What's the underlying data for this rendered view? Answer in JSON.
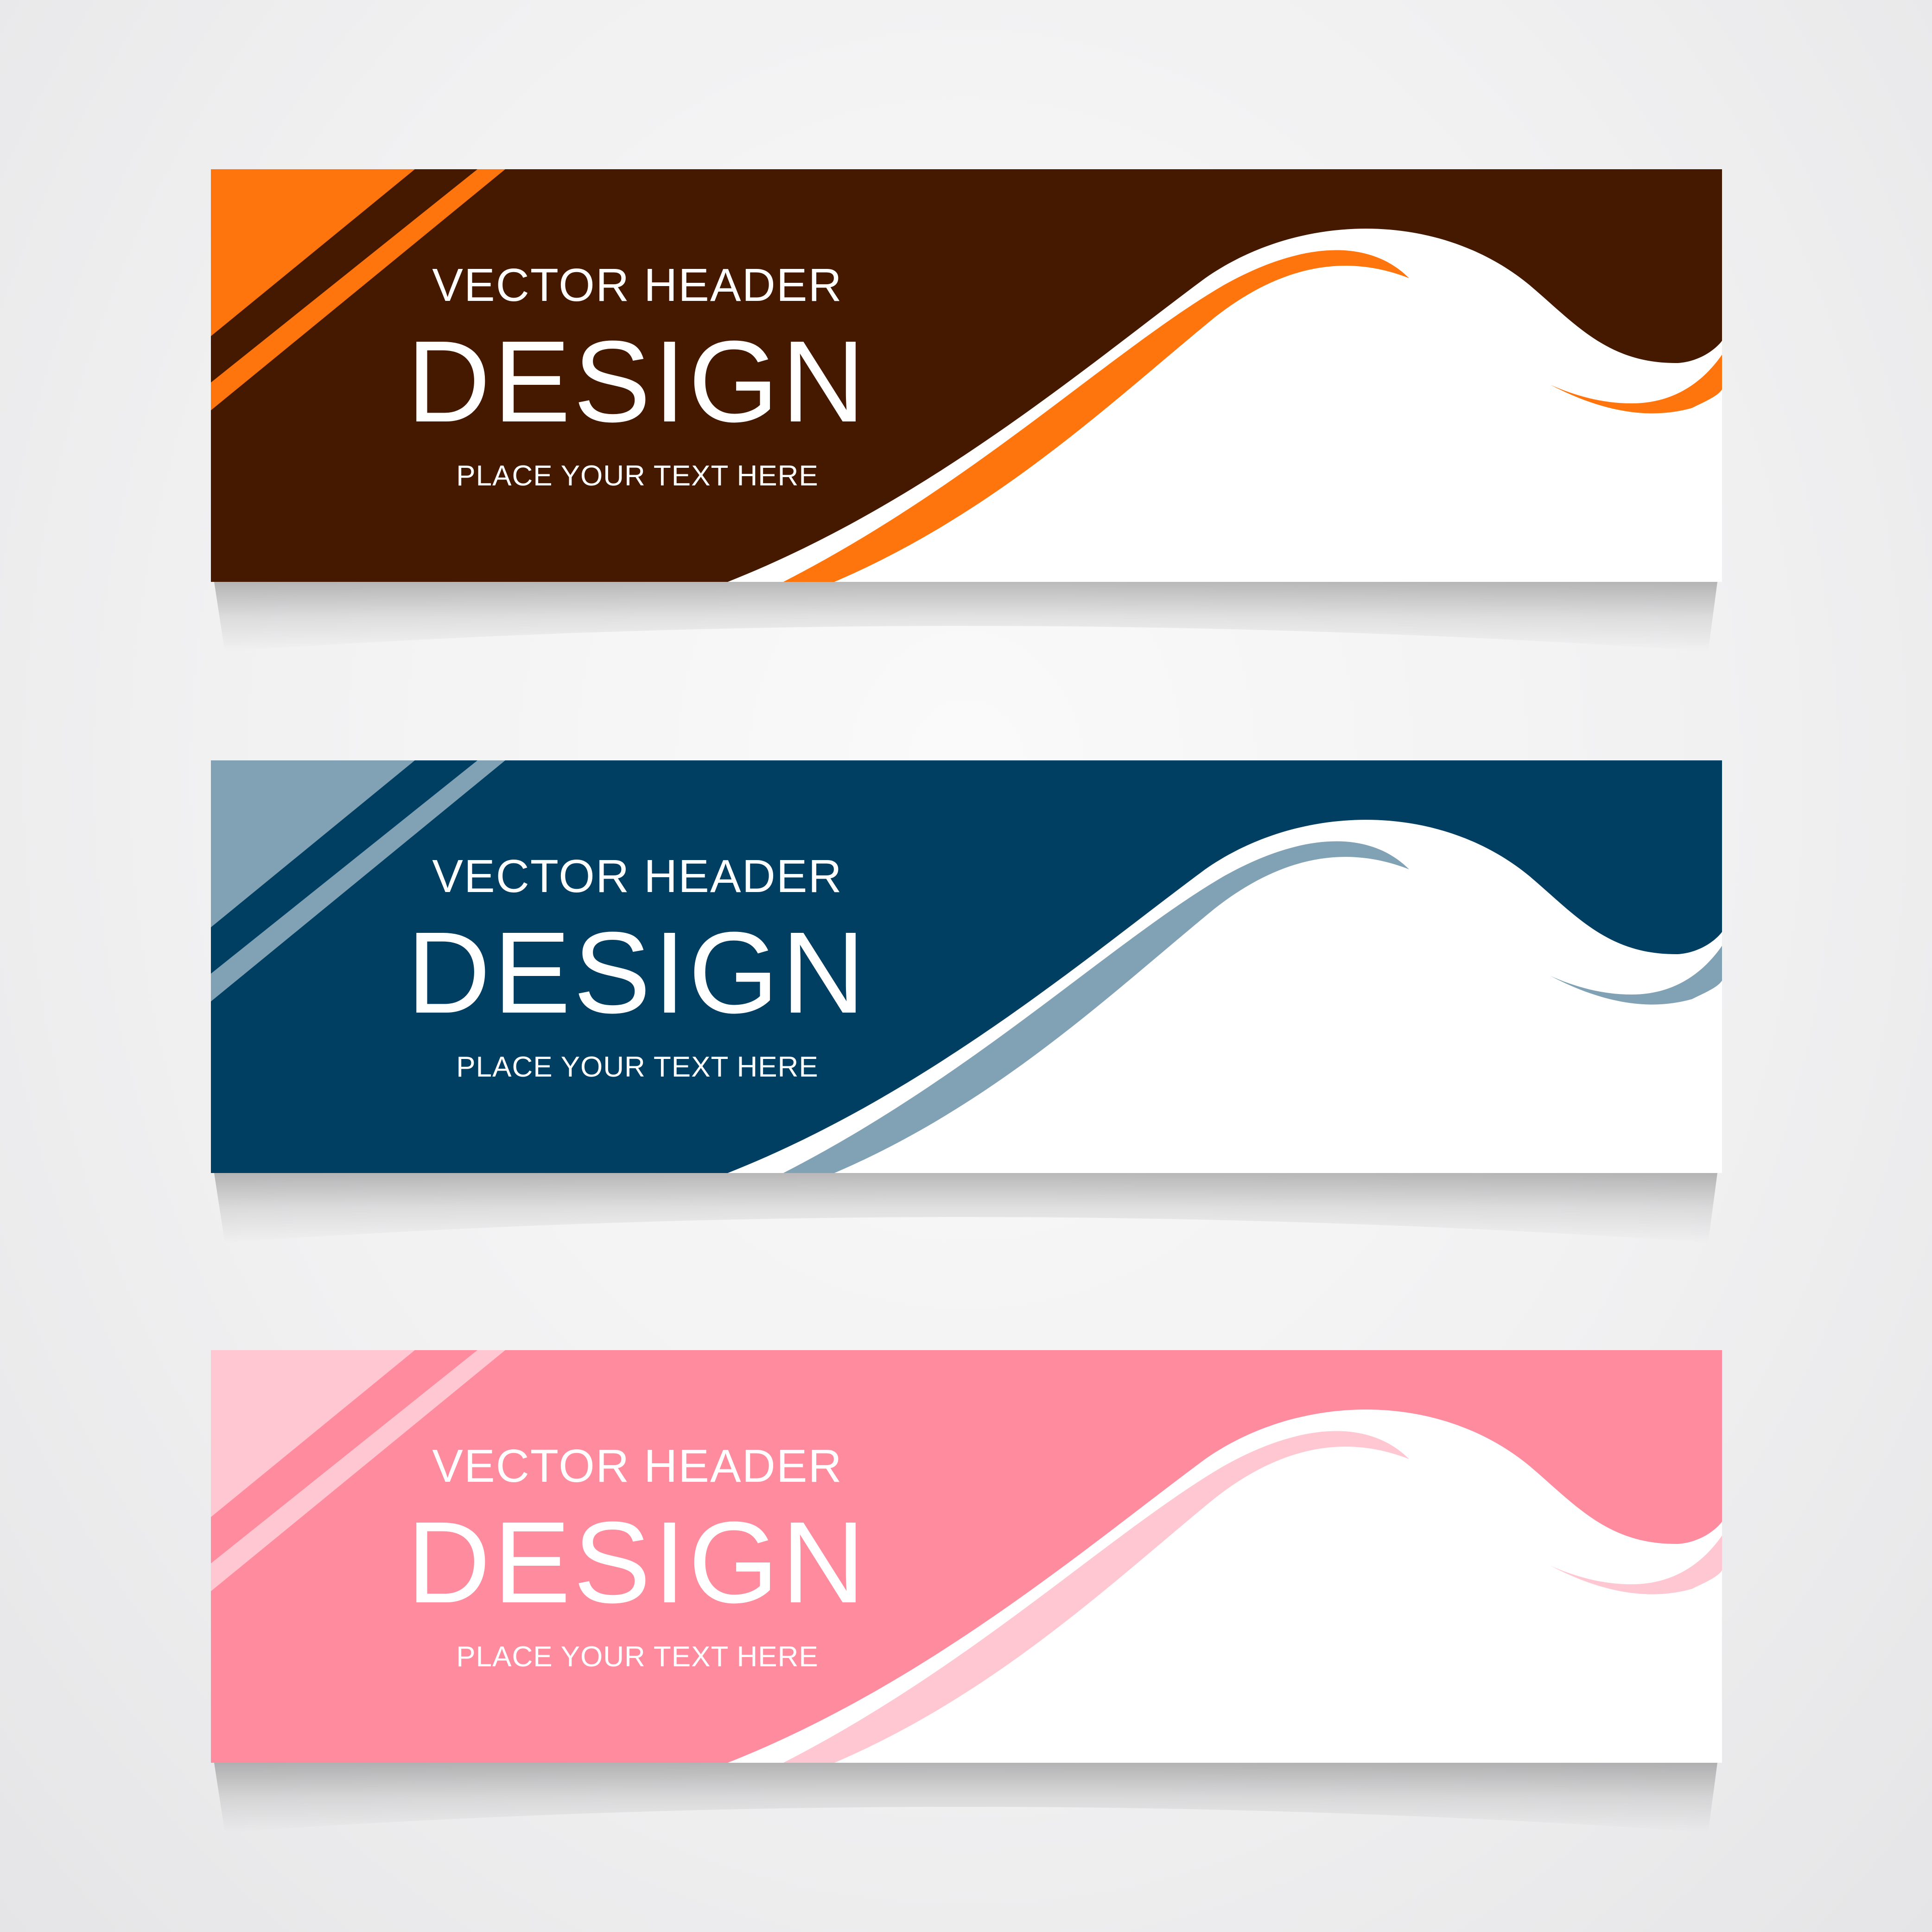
{
  "banners": [
    {
      "eyebrow": "VECTOR HEADER",
      "headline": "DESIGN",
      "tagline": "PLACE YOUR TEXT HERE",
      "colors": {
        "base": "#441900",
        "accent": "#ff750d",
        "fill": "#ffffff"
      }
    },
    {
      "eyebrow": "VECTOR HEADER",
      "headline": "DESIGN",
      "tagline": "PLACE YOUR TEXT HERE",
      "colors": {
        "base": "#003f62",
        "accent": "#81a1b5",
        "fill": "#ffffff"
      }
    },
    {
      "eyebrow": "VECTOR HEADER",
      "headline": "DESIGN",
      "tagline": "PLACE YOUR TEXT HERE",
      "colors": {
        "base": "#ff8c9e",
        "accent": "#ffc7d1",
        "fill": "#ffffff"
      }
    }
  ]
}
